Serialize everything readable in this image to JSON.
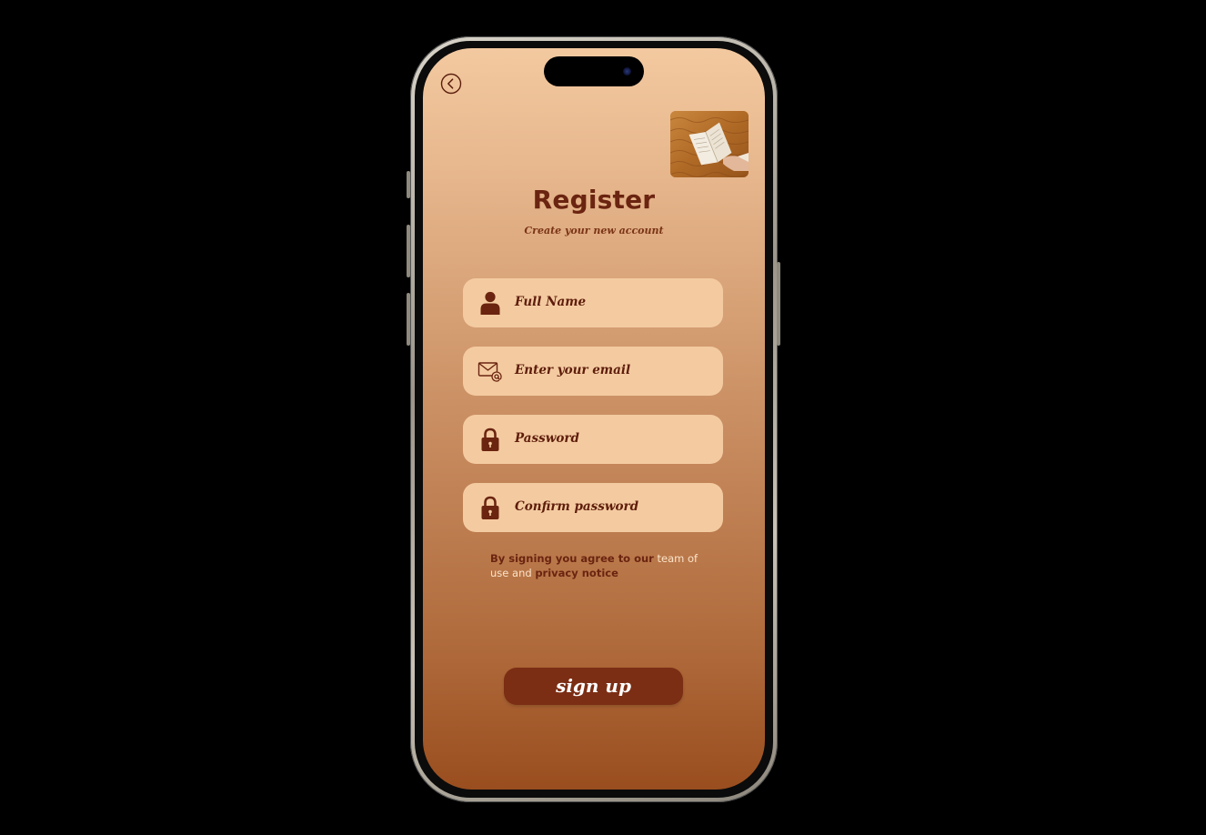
{
  "screen": {
    "title": "Register",
    "subtitle": "Create your new account"
  },
  "icons": {
    "back": "chevron-left-circle-icon",
    "full_name": "user-icon",
    "email": "mail-at-icon",
    "password": "lock-icon",
    "confirm_password": "lock-icon",
    "photo": "open-book-photo"
  },
  "form": {
    "full_name_placeholder": "Full Name",
    "email_placeholder": "Enter your email",
    "password_placeholder": "Password",
    "confirm_password_placeholder": "Confirm password"
  },
  "terms": {
    "prefix": "By signing you agree to our",
    "link1": "team of use",
    "conjunction": "and",
    "link2": "privacy notice"
  },
  "actions": {
    "signup_label": "sign up"
  },
  "colors": {
    "accent": "#7b2e14",
    "field_bg": "#f4cba1",
    "text_dark": "#6a2410",
    "gradient_top": "#f3c9a0",
    "gradient_bottom": "#9a4e1f"
  }
}
